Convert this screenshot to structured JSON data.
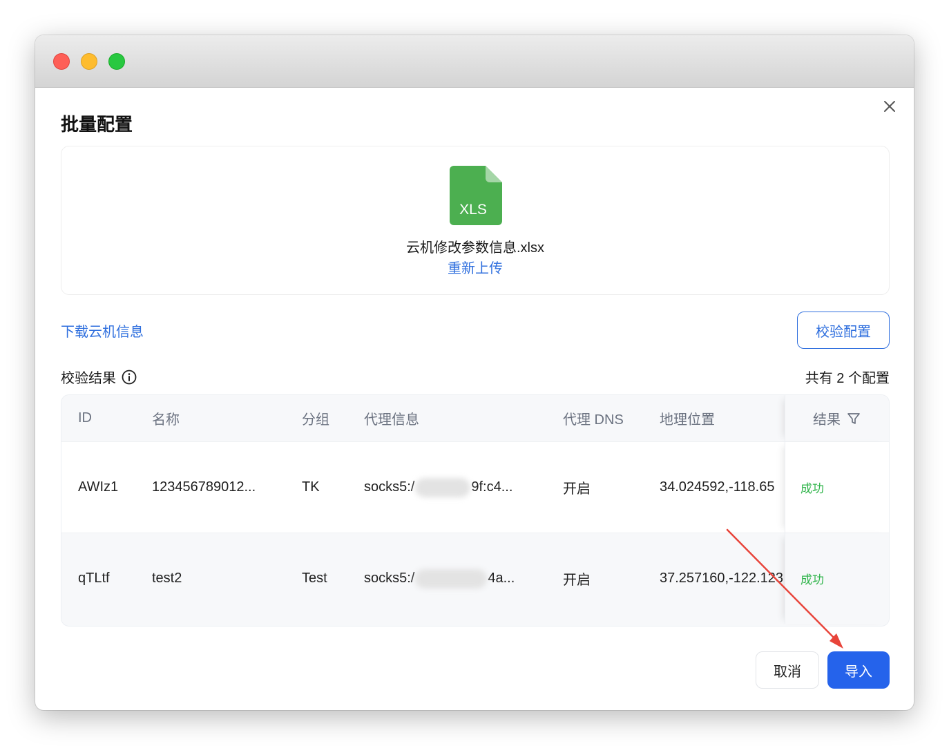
{
  "dialog": {
    "title": "批量配置",
    "upload": {
      "file_icon_label": "XLS",
      "file_name": "云机修改参数信息.xlsx",
      "reupload_label": "重新上传"
    },
    "download_link": "下载云机信息",
    "verify_button": "校验配置",
    "result_label": "校验结果",
    "count_label": "共有 2 个配置",
    "table": {
      "headers": {
        "id": "ID",
        "name": "名称",
        "group": "分组",
        "proxy": "代理信息",
        "dns": "代理 DNS",
        "geo": "地理位置",
        "result": "结果"
      },
      "rows": [
        {
          "id": "AWIz1",
          "name": "123456789012...",
          "group": "TK",
          "proxy_prefix": "socks5:/",
          "proxy_suffix": "9f:c4...",
          "dns": "开启",
          "geo": "34.024592,-118.65",
          "result": "成功"
        },
        {
          "id": "qTLtf",
          "name": "test2",
          "group": "Test",
          "proxy_prefix": "socks5:/",
          "proxy_suffix": "4a...",
          "dns": "开启",
          "geo": "37.257160,-122.123",
          "result": "成功"
        }
      ]
    },
    "cancel_button": "取消",
    "import_button": "导入"
  },
  "colors": {
    "accent": "#2f6fde",
    "primary_button": "#2563eb",
    "success": "#2fb44a",
    "xls_green": "#4caf50",
    "annotation_arrow": "#e8443a"
  }
}
